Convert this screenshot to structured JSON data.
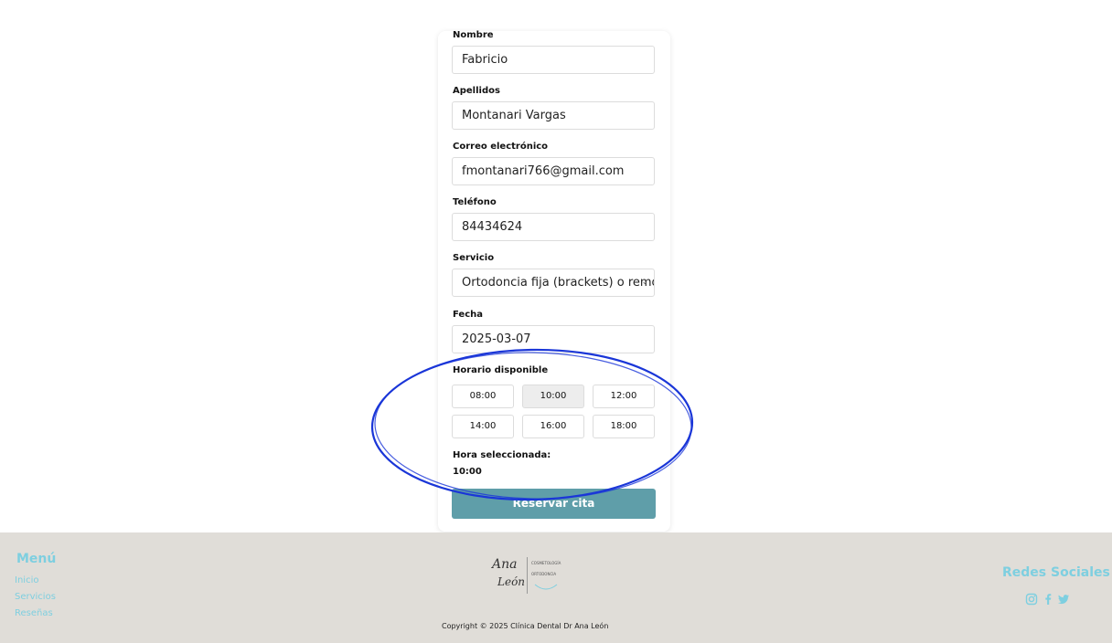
{
  "form": {
    "name_label": "Nombre",
    "name_value": "Fabricio",
    "last_label": "Apellidos",
    "last_value": "Montanari Vargas",
    "email_label": "Correo electrónico",
    "email_value": "fmontanari766@gmail.com",
    "phone_label": "Teléfono",
    "phone_value": "84434624",
    "service_label": "Servicio",
    "service_value": "Ortodoncia fija (brackets) o remo",
    "date_label": "Fecha",
    "date_value": "2025-03-07",
    "schedule_label": "Horario disponible",
    "slots": [
      "08:00",
      "10:00",
      "12:00",
      "14:00",
      "16:00",
      "18:00"
    ],
    "selected_slot": "10:00",
    "selected_label": "Hora seleccionada:",
    "selected_value": "10:00",
    "submit_label": "Reservar cita"
  },
  "footer": {
    "menu_title": "Menú",
    "menu_items": [
      "Inicio",
      "Servicios",
      "Reseñas"
    ],
    "logo_text_1": "Ana",
    "logo_text_2": "León",
    "logo_sub_1": "COSMETOLOGÍA",
    "logo_sub_2": "ORTODONCIA",
    "copyright": "Copyright © 2025 Clínica Dental Dr Ana León",
    "social_title": "Redes Sociales",
    "social_icons": [
      "instagram-icon",
      "facebook-icon",
      "twitter-icon"
    ]
  },
  "colors": {
    "accent": "#7ecfe0",
    "button": "#5f9ea9",
    "footer_bg": "#e0ddd8",
    "annotation": "#1a36d8"
  }
}
